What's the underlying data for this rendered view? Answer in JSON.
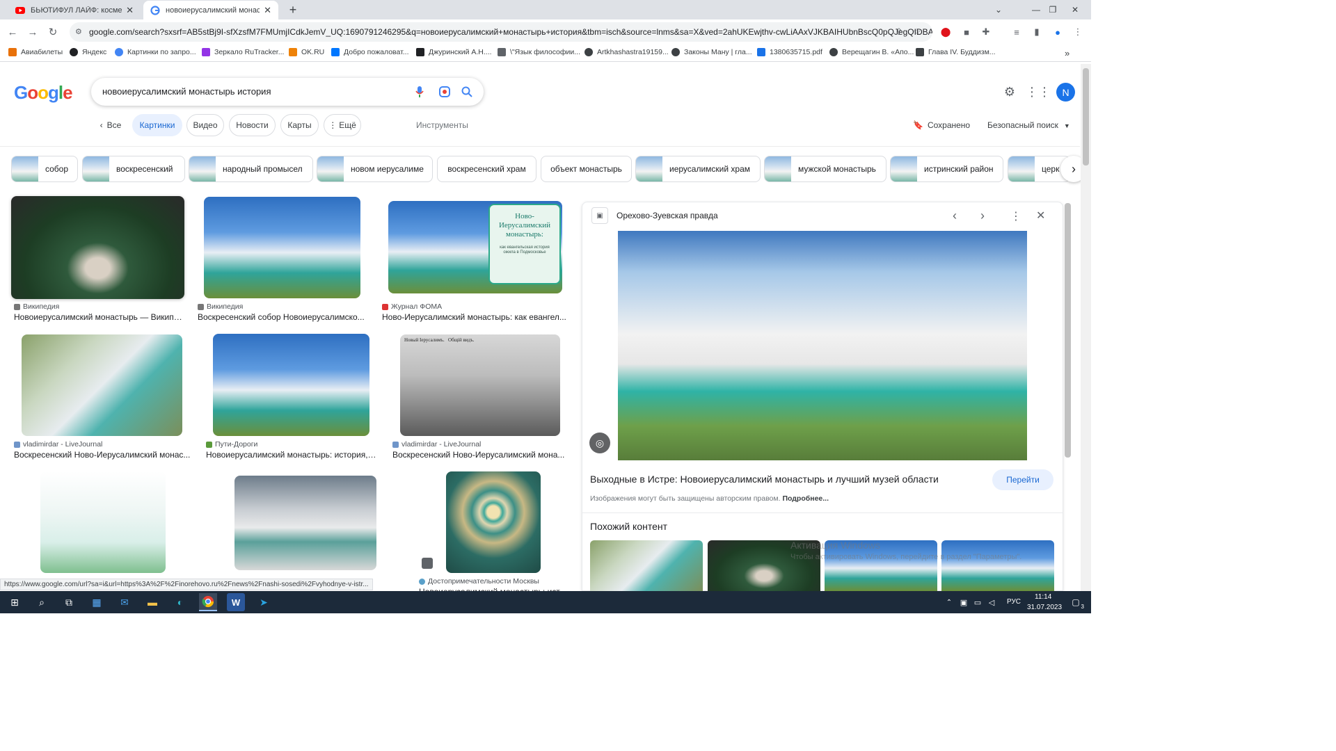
{
  "browser": {
    "tabs": [
      {
        "title": "БЬЮТИФУЛ ЛАЙФ: косметолог...",
        "active": false
      },
      {
        "title": "новоиерусалимский монастырь...",
        "active": true
      }
    ],
    "new_tab": "+",
    "url": "google.com/search?sxsrf=AB5stBj9I-sfXzsfM7FMUmjICdkJemV_UQ:1690791246295&q=новоиерусалимский+монастырь+история&tbm=isch&source=lnms&sa=X&ved=2ahUKEwjthv-cwLiAAxVJKBAIHUbnBscQ0pQJegQIDBA...",
    "bookmarks": [
      {
        "label": "Авиабилеты",
        "color": "#e8710a"
      },
      {
        "label": "Яндекс",
        "color": "#202124"
      },
      {
        "label": "Картинки по запро...",
        "color": "#4285f4"
      },
      {
        "label": "Зеркало RuTracker...",
        "color": "#9334e6"
      },
      {
        "label": "OK.RU",
        "color": "#ee8208"
      },
      {
        "label": "Добро пожаловат...",
        "color": "#0077ff"
      },
      {
        "label": "Джуринский А.Н....",
        "color": "#202124"
      },
      {
        "label": "\\\"Язык философии...",
        "color": "#5f6368"
      },
      {
        "label": "Artkhashastra19159...",
        "color": "#3c4043"
      },
      {
        "label": "Законы Ману | гла...",
        "color": "#3c4043"
      },
      {
        "label": "1380635715.pdf",
        "color": "#1a73e8"
      },
      {
        "label": "Верещагин В. «Апо...",
        "color": "#3c4043"
      },
      {
        "label": "Глава IV. Буддизм...",
        "color": "#3c4043"
      }
    ],
    "more_bookmarks": "»"
  },
  "google": {
    "logo": "Google",
    "query": "новоиерусалимский монастырь история",
    "filters": {
      "all": "Все",
      "images": "Картинки",
      "video": "Видео",
      "news": "Новости",
      "maps": "Карты",
      "more": "Ещё",
      "tools": "Инструменты",
      "saved": "Сохранено",
      "safe_search": "Безопасный поиск"
    },
    "avatar_letter": "N",
    "related": [
      {
        "label": "собор",
        "img": true
      },
      {
        "label": "воскресенский",
        "img": true
      },
      {
        "label": "народный промысел",
        "img": true
      },
      {
        "label": "новом иерусалиме",
        "img": true
      },
      {
        "label": "воскресенский храм",
        "img": false
      },
      {
        "label": "объект монастырь",
        "img": false
      },
      {
        "label": "иерусалимский храм",
        "img": true
      },
      {
        "label": "мужской монастырь",
        "img": true
      },
      {
        "label": "истринский район",
        "img": true
      },
      {
        "label": "церк",
        "img": true
      }
    ],
    "results": [
      {
        "source": "Википедия",
        "title": "Новоиерусалимский монастырь — Википе..."
      },
      {
        "source": "Википедия",
        "title": "Воскресенский собор Новоиерусалимско..."
      },
      {
        "source": "Журнал ФОМА",
        "title": "Ново-Иерусалимский монастырь: как евангел..."
      },
      {
        "source": "vladimirdar - LiveJournal",
        "title": "Воскресенский Ново-Иерусалимский монас..."
      },
      {
        "source": "Пути-Дороги",
        "title": "Новоиерусалимский монастырь: история, ..."
      },
      {
        "source": "vladimirdar - LiveJournal",
        "title": "Воскресенский Ново-Иерусалимский мона..."
      },
      {
        "source": "",
        "title": ""
      },
      {
        "source": "",
        "title": ""
      },
      {
        "source": "Достопримечательности Москвы",
        "title": "Новоиерусалимский монастырь: ист..."
      }
    ],
    "foma_overlay": "Ново-Иерусалимский монастырь:",
    "foma_overlay_sub": "как евангельская история ожила в Подмосковье",
    "bw_caption": "Новый Іерусалимъ.   Общій видъ."
  },
  "panel": {
    "source": "Орехово-Зуевская правда",
    "title": "Выходные в Истре: Новоиерусалимский монастырь и лучший музей области",
    "goto": "Перейти",
    "copyright": "Изображения могут быть защищены авторским правом.",
    "more": "Подробнее...",
    "similar": "Похожий контент"
  },
  "status_url": "https://www.google.com/url?sa=i&url=https%3A%2F%2Finorehovo.ru%2Fnews%2Fnashi-sosedi%2Fvyhodnye-v-istr...",
  "watermark": {
    "line1": "Активация Windows",
    "line2": "Чтобы активировать Windows, перейдите в раздел \"Параметры\"."
  },
  "taskbar": {
    "lang": "РУС",
    "time": "11:14",
    "date": "31.07.2023",
    "notif": "3"
  },
  "colors": {
    "accent": "#1a73e8",
    "chip_active_bg": "#e8f0fe",
    "taskbar": "#1c2a3a"
  }
}
